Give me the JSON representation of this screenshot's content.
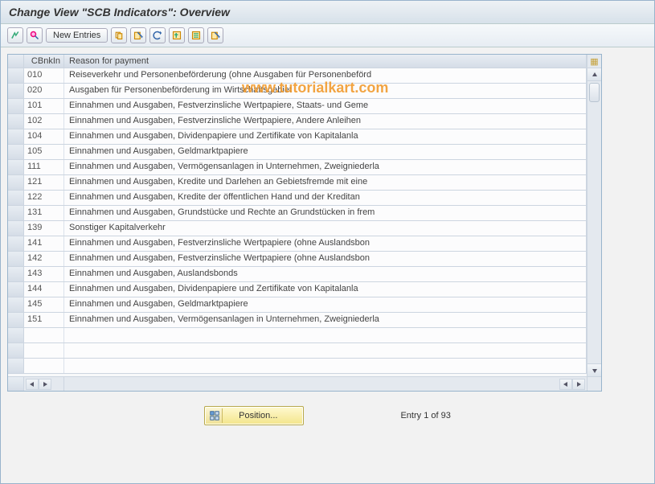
{
  "title": "Change View \"SCB Indicators\": Overview",
  "watermark": "www.tutorialkart.com",
  "toolbar": {
    "new_entries_label": "New Entries"
  },
  "table": {
    "col_a_header": "CBnkIn",
    "col_b_header": "Reason for payment",
    "rows": [
      {
        "code": "010",
        "text": "Reiseverkehr und Personenbeförderung (ohne Ausgaben für Personenbeförd"
      },
      {
        "code": "020",
        "text": "Ausgaben für Personenbeförderung im Wirtschaftsgebiet"
      },
      {
        "code": "101",
        "text": "Einnahmen und Ausgaben, Festverzinsliche Wertpapiere, Staats- und Geme"
      },
      {
        "code": "102",
        "text": "Einnahmen und Ausgaben, Festverzinsliche Wertpapiere, Andere Anleihen"
      },
      {
        "code": "104",
        "text": "Einnahmen und Ausgaben, Dividenpapiere und Zertifikate von Kapitalanla"
      },
      {
        "code": "105",
        "text": "Einnahmen und Ausgaben, Geldmarktpapiere"
      },
      {
        "code": "111",
        "text": "Einnahmen und Ausgaben, Vermögensanlagen in Unternehmen, Zweigniederla"
      },
      {
        "code": "121",
        "text": "Einnahmen und Ausgaben, Kredite und Darlehen an Gebietsfremde mit eine"
      },
      {
        "code": "122",
        "text": "Einnahmen und Ausgaben, Kredite der öffentlichen Hand und der Kreditan"
      },
      {
        "code": "131",
        "text": "Einnahmen und Ausgaben, Grundstücke und Rechte an Grundstücken in frem"
      },
      {
        "code": "139",
        "text": "Sonstiger Kapitalverkehr"
      },
      {
        "code": "141",
        "text": "Einnahmen und Ausgaben, Festverzinsliche Wertpapiere (ohne Auslandsbon"
      },
      {
        "code": "142",
        "text": "Einnahmen und Ausgaben, Festverzinsliche Wertpapiere (ohne Auslandsbon"
      },
      {
        "code": "143",
        "text": "Einnahmen und Ausgaben, Auslandsbonds"
      },
      {
        "code": "144",
        "text": "Einnahmen und Ausgaben, Dividenpapiere und Zertifikate von Kapitalanla"
      },
      {
        "code": "145",
        "text": "Einnahmen und Ausgaben, Geldmarktpapiere"
      },
      {
        "code": "151",
        "text": "Einnahmen und Ausgaben, Vermögensanlagen in Unternehmen, Zweigniederla"
      }
    ]
  },
  "footer": {
    "position_label": "Position...",
    "entry_count": "Entry 1 of 93"
  }
}
